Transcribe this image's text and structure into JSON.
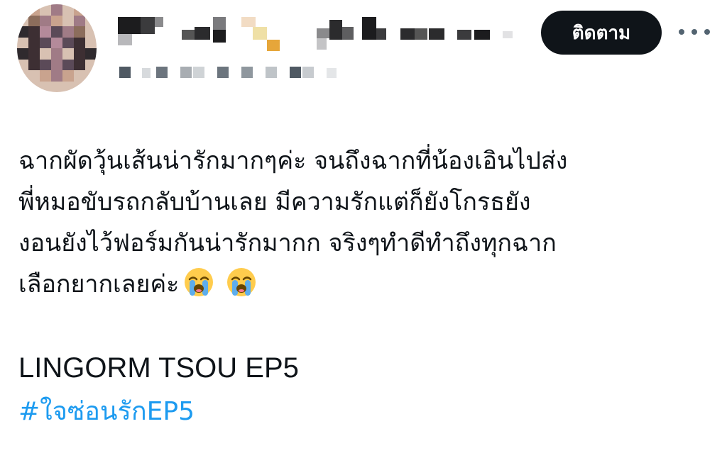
{
  "header": {
    "follow_label": "ติดตาม",
    "more_icon": "more-horizontal-icon",
    "avatar_colors": [
      "#3d2f33",
      "#8c6d5c",
      "#c9a38e",
      "#a07b86",
      "#5b4a58",
      "#d8c1b2",
      "#2f2a2e",
      "#b48a9a"
    ]
  },
  "tweet": {
    "lines": [
      "ฉากผัดวุ้นเส้นน่ารักมากๆค่ะ จนถึงฉากที่น้องเอินไปส่ง",
      "พี่หมอขับรถกลับบ้านเลย มีความรักแต่ก็ยังโกรธยัง",
      "งอนยังไว้ฟอร์มกันน่ารักมากก จริงๆทำดีทำถึงทุกฉาก",
      "เลือกยากเลยค่ะ"
    ],
    "emoji": [
      "loudly-crying-face-emoji",
      "loudly-crying-face-emoji"
    ],
    "title_line": "LINGORM TSOU EP5",
    "hashtag": "#ใจซ่อนรักEP5",
    "hashtag_color": "#1d9bf0",
    "text_color": "#0f1419"
  }
}
